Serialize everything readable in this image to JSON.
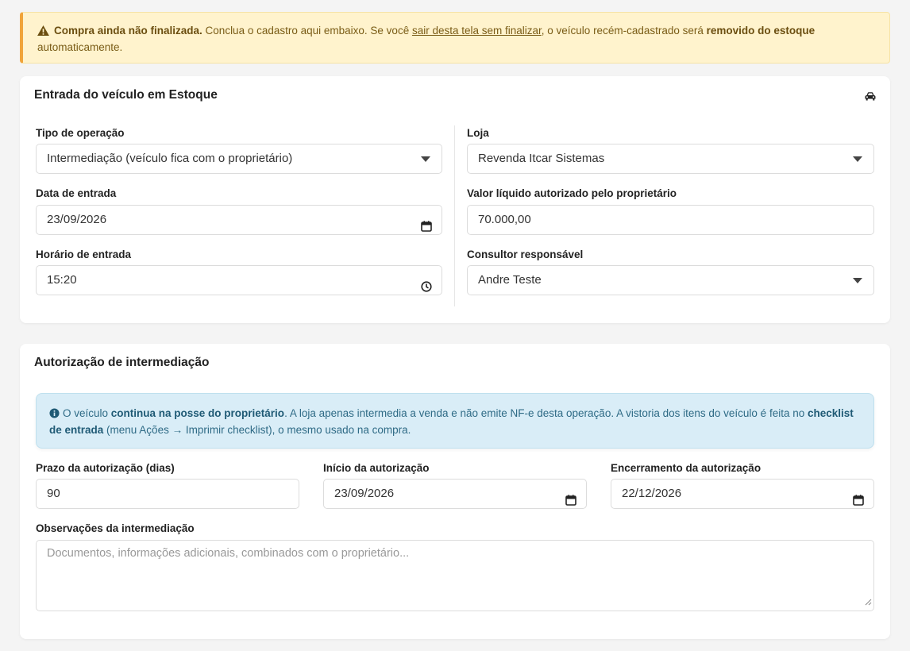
{
  "warning": {
    "strong_lead": "Compra ainda não finalizada.",
    "text1": " Conclua o cadastro aqui embaixo. Se você ",
    "link": "sair desta tela sem finalizar",
    "text2": ", o veículo recém-cadastrado será ",
    "strong_end": "removido do estoque",
    "text3": " automaticamente."
  },
  "entry_card": {
    "title": "Entrada do veículo em Estoque",
    "operation_type": {
      "label": "Tipo de operação",
      "value": "Intermediação (veículo fica com o proprietário)"
    },
    "store": {
      "label": "Loja",
      "value": "Revenda Itcar Sistemas"
    },
    "entry_date": {
      "label": "Data de entrada",
      "value": "23/09/2026"
    },
    "net_value": {
      "label": "Valor líquido autorizado pelo proprietário",
      "value": "70.000,00"
    },
    "entry_time": {
      "label": "Horário de entrada",
      "value": "15:20"
    },
    "consultant": {
      "label": "Consultor responsável",
      "value": "Andre Teste"
    }
  },
  "authorization_card": {
    "title": "Autorização de intermediação",
    "info": {
      "t1": "O veículo ",
      "b1": "continua na posse do proprietário",
      "t2": ". A loja apenas intermedia a venda e não emite NF-e desta operação. A vistoria dos itens do veículo é feita no ",
      "b2": "checklist de entrada",
      "t3": " (menu Ações → Imprimir checklist), o mesmo usado na compra."
    },
    "term_days": {
      "label": "Prazo da autorização (dias)",
      "value": "90"
    },
    "start_date": {
      "label": "Início da autorização",
      "value": "23/09/2026"
    },
    "end_date": {
      "label": "Encerramento da autorização",
      "value": "22/12/2026"
    },
    "notes": {
      "label": "Observações da intermediação",
      "placeholder": "Documentos, informações adicionais, combinados com o proprietário..."
    }
  },
  "icons": {
    "warning": "warning-triangle-icon",
    "car": "car-icon",
    "info": "info-circle-icon",
    "calendar": "calendar-icon",
    "clock": "clock-icon",
    "dropdown": "chevron-down-icon"
  },
  "colors": {
    "warning_bg": "#fff3cd",
    "warning_accent": "#f0a43a",
    "info_bg": "#d9edf7"
  }
}
